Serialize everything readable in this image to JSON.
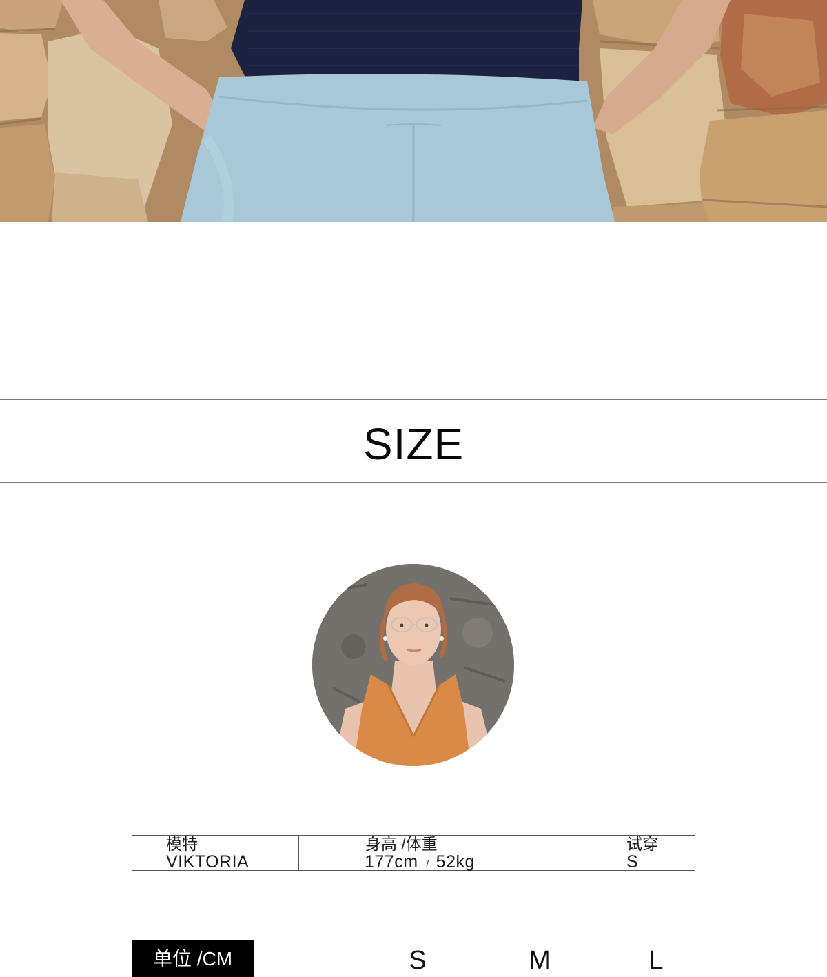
{
  "section": {
    "title": "SIZE"
  },
  "model_info": {
    "headers": {
      "model": "模特",
      "height_weight": "身高 /体重",
      "try_on": "试穿"
    },
    "values": {
      "model_name": "VIKTORIA",
      "height": "177cm",
      "separator": "/",
      "weight": "52kg",
      "size": "S"
    }
  },
  "size_chart": {
    "unit_label": "单位 /CM",
    "sizes": [
      "S",
      "M",
      "L"
    ]
  },
  "colors": {
    "legging": "#a8c8d6",
    "top": "#1b2340",
    "bra": "#d98a47",
    "stone_wall": "#c9a478",
    "avatar_background": "#6f6b66",
    "badge": "#000000"
  }
}
